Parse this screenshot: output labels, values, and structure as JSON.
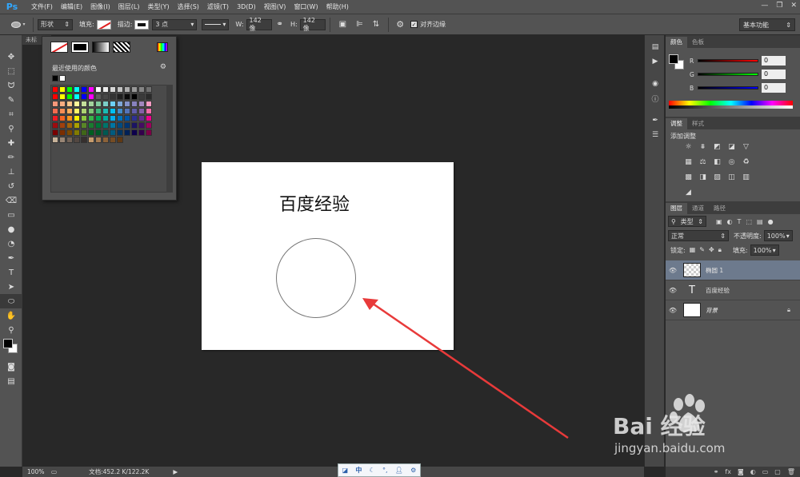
{
  "app": {
    "logo": "Ps"
  },
  "menu": [
    "文件(F)",
    "编辑(E)",
    "图像(I)",
    "图层(L)",
    "类型(Y)",
    "选择(S)",
    "滤镜(T)",
    "3D(D)",
    "视图(V)",
    "窗口(W)",
    "帮助(H)"
  ],
  "options": {
    "mode": "形状",
    "fill_label": "填充:",
    "stroke_label": "描边:",
    "stroke_width": "3 点",
    "w_label": "W:",
    "w_value": "142 像",
    "h_label": "H:",
    "h_value": "142 像",
    "align_edges": "对齐边缘",
    "workspace": "基本功能"
  },
  "document": {
    "tab": "未标"
  },
  "canvas": {
    "text": "百度经验"
  },
  "color_popup": {
    "title": "最近使用的颜色",
    "recent": [
      "#000000",
      "#ffffff"
    ],
    "swatches": [
      "#ff0000",
      "#ffff00",
      "#00ff00",
      "#00ffff",
      "#0000ff",
      "#ff00ff",
      "#ffffff",
      "#ebebeb",
      "#d6d6d6",
      "#c2c2c2",
      "#adadad",
      "#999999",
      "#858585",
      "#707070",
      "#ff0000",
      "#ffff00",
      "#00ff00",
      "#00ffff",
      "#0000ff",
      "#ff00ff",
      "#5c5c5c",
      "#474747",
      "#333333",
      "#1f1f1f",
      "#0a0a0a",
      "#000000",
      "#3a3a3a",
      "#2a2a2a",
      "#f7977a",
      "#f9ad81",
      "#fdc68a",
      "#fff79a",
      "#c4df9b",
      "#a2d39c",
      "#82ca9d",
      "#7bcdc8",
      "#6ecff6",
      "#7ea7d8",
      "#8493ca",
      "#8882be",
      "#a187be",
      "#f49ac2",
      "#f26c4f",
      "#f68e55",
      "#fbaf5c",
      "#fff467",
      "#acd372",
      "#7cc576",
      "#3bb878",
      "#1abbb4",
      "#00bff3",
      "#438cca",
      "#5574b9",
      "#605ca8",
      "#855fa8",
      "#f06ea9",
      "#ed1c24",
      "#f26522",
      "#f7941d",
      "#fff200",
      "#8dc73f",
      "#39b54a",
      "#00a651",
      "#00a99d",
      "#00aeef",
      "#0072bc",
      "#0054a6",
      "#2e3192",
      "#662d91",
      "#ec008c",
      "#9e0b0f",
      "#a0410d",
      "#a3620a",
      "#aba000",
      "#598527",
      "#1a7b30",
      "#007236",
      "#00746b",
      "#0076a3",
      "#004b80",
      "#003471",
      "#1b1464",
      "#440e62",
      "#9e005d",
      "#790000",
      "#7b2e00",
      "#7d4900",
      "#827b00",
      "#406618",
      "#005e20",
      "#005826",
      "#005952",
      "#005b7f",
      "#003663",
      "#002157",
      "#0d004c",
      "#32004b",
      "#7b0046",
      "#c7b299",
      "#998675",
      "#736357",
      "#534741",
      "#362f2d",
      "#c69c6d",
      "#a67c52",
      "#8c6239",
      "#754c24",
      "#603913"
    ]
  },
  "color_panel": {
    "tabs": [
      "颜色",
      "色板"
    ],
    "r_label": "R",
    "g_label": "G",
    "b_label": "B",
    "r": "0",
    "g": "0",
    "b": "0"
  },
  "adjust_panel": {
    "tabs": [
      "调整",
      "样式"
    ],
    "title": "添加调整"
  },
  "layers_panel": {
    "tabs": [
      "图层",
      "通道",
      "路径"
    ],
    "filter": "类型",
    "blend": "正常",
    "opacity_label": "不透明度:",
    "opacity": "100%",
    "lock_label": "锁定:",
    "fill_label": "填充:",
    "fill": "100%",
    "layers": [
      {
        "name": "椭圆 1",
        "kind": "shape",
        "selected": true
      },
      {
        "name": "百度经验",
        "kind": "text",
        "selected": false
      },
      {
        "name": "背景",
        "kind": "background",
        "selected": false
      }
    ]
  },
  "status": {
    "zoom": "100%",
    "doc": "文档:452.2 K/122.2K"
  },
  "ime": {
    "label": "中"
  },
  "watermark": {
    "brand": "Bai  经验",
    "url": "jingyan.baidu.com"
  }
}
